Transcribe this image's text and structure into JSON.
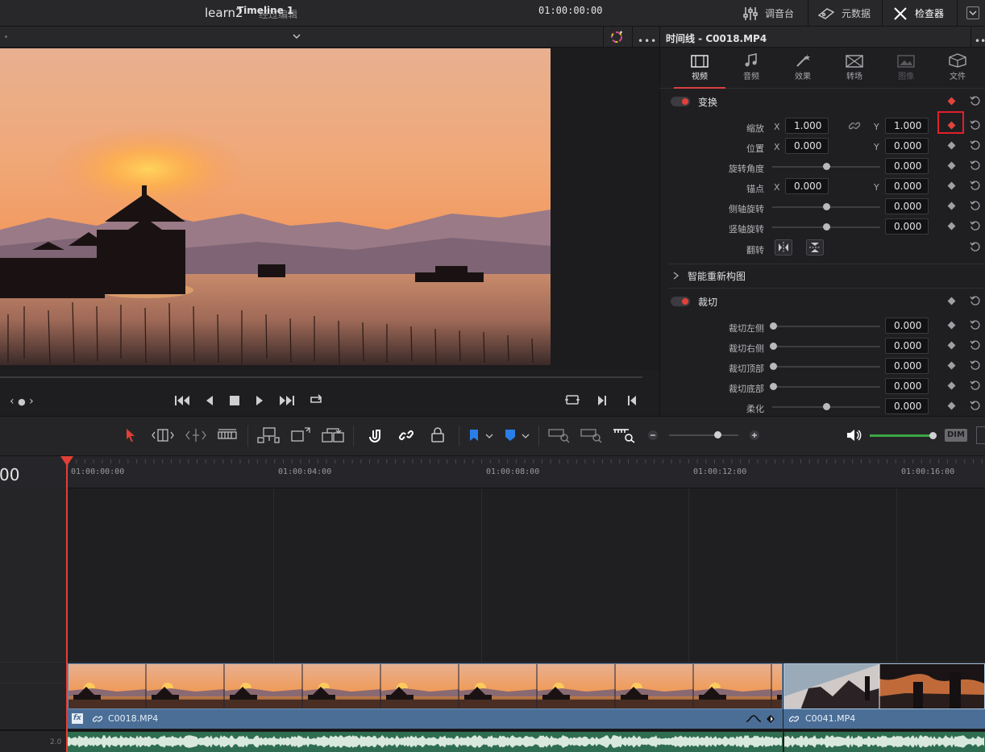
{
  "topbar": {
    "project_name": "learn2",
    "project_subtitle": "经过编辑",
    "mixer_label": "调音台",
    "metadata_label": "元数据",
    "inspector_label": "检查器"
  },
  "viewer": {
    "timeline_name": "Timeline 1",
    "timecode": "01:00:00:00"
  },
  "inspector": {
    "title": "时间线 - C0018.MP4",
    "tabs": [
      {
        "label": "视频",
        "icon": "film-icon",
        "state": "active"
      },
      {
        "label": "音频",
        "icon": "music-note-icon",
        "state": "normal"
      },
      {
        "label": "效果",
        "icon": "magic-wand-icon",
        "state": "normal"
      },
      {
        "label": "转场",
        "icon": "transition-icon",
        "state": "normal"
      },
      {
        "label": "图像",
        "icon": "image-icon",
        "state": "disabled"
      },
      {
        "label": "文件",
        "icon": "file-icon",
        "state": "normal"
      }
    ],
    "transform": {
      "title": "变换",
      "zoom": {
        "label": "缩放",
        "x_axis": "X",
        "x": "1.000",
        "y_axis": "Y",
        "y": "1.000"
      },
      "position": {
        "label": "位置",
        "x_axis": "X",
        "x": "0.000",
        "y_axis": "Y",
        "y": "0.000"
      },
      "rotation": {
        "label": "旋转角度",
        "value": "0.000"
      },
      "anchor": {
        "label": "锚点",
        "x_axis": "X",
        "x": "0.000",
        "y_axis": "Y",
        "y": "0.000"
      },
      "pitch": {
        "label": "侧轴旋转",
        "value": "0.000"
      },
      "yaw": {
        "label": "竖轴旋转",
        "value": "0.000"
      },
      "flip": {
        "label": "翻转"
      }
    },
    "smart_reframe": {
      "title": "智能重新构图"
    },
    "cropping": {
      "title": "裁切",
      "left": {
        "label": "裁切左侧",
        "value": "0.000"
      },
      "right": {
        "label": "裁切右侧",
        "value": "0.000"
      },
      "top": {
        "label": "裁切顶部",
        "value": "0.000"
      },
      "bottom": {
        "label": "裁切底部",
        "value": "0.000"
      },
      "softness": {
        "label": "柔化",
        "value": "0.000"
      }
    }
  },
  "timeline": {
    "current_timecode": "00",
    "ruler": [
      "01:00:00:00",
      "01:00:04:00",
      "01:00:08:00",
      "01:00:12:00",
      "01:00:16:00"
    ],
    "dim_label": "DIM",
    "audio_level": "2.0",
    "clips": [
      {
        "name": "C0018.MP4",
        "fx_badge": "fx"
      },
      {
        "name": "C0041.MP4"
      }
    ]
  },
  "colors": {
    "accent_red": "#e04038",
    "clip_blue": "#4a6e96",
    "audio_green": "#2f6d50",
    "volume_green": "#3aa844",
    "marker_blue": "#2a7ee8"
  }
}
